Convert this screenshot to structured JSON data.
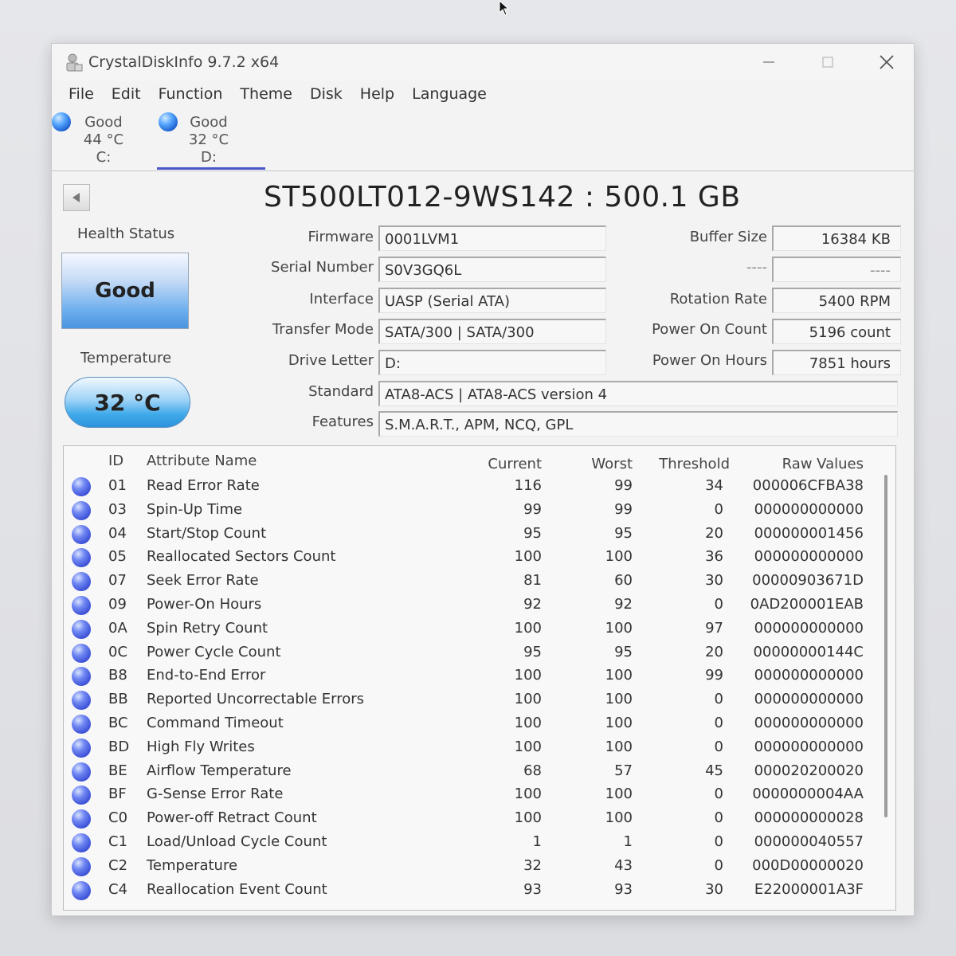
{
  "window": {
    "title": "CrystalDiskInfo 9.7.2 x64"
  },
  "menu": [
    "File",
    "Edit",
    "Function",
    "Theme",
    "Disk",
    "Help",
    "Language"
  ],
  "drives": [
    {
      "status": "Good",
      "temp": "44 °C",
      "letter": "C:"
    },
    {
      "status": "Good",
      "temp": "32 °C",
      "letter": "D:"
    }
  ],
  "model_title": "ST500LT012-9WS142 : 500.1 GB",
  "health": {
    "label": "Health Status",
    "value": "Good"
  },
  "temperature": {
    "label": "Temperature",
    "value": "32 °C"
  },
  "fields": {
    "firmware": {
      "label": "Firmware",
      "value": "0001LVM1"
    },
    "serial": {
      "label": "Serial Number",
      "value": "S0V3GQ6L"
    },
    "interface": {
      "label": "Interface",
      "value": "UASP (Serial ATA)"
    },
    "transfer": {
      "label": "Transfer Mode",
      "value": "SATA/300 | SATA/300"
    },
    "letter": {
      "label": "Drive Letter",
      "value": "D:"
    },
    "standard": {
      "label": "Standard",
      "value": "ATA8-ACS | ATA8-ACS version 4"
    },
    "features": {
      "label": "Features",
      "value": "S.M.A.R.T., APM, NCQ, GPL"
    },
    "buffer": {
      "label": "Buffer Size",
      "value": "16384 KB"
    },
    "blank": {
      "label": "----",
      "value": "----"
    },
    "rotation": {
      "label": "Rotation Rate",
      "value": "5400 RPM"
    },
    "power_count": {
      "label": "Power On Count",
      "value": "5196 count"
    },
    "power_hours": {
      "label": "Power On Hours",
      "value": "7851 hours"
    }
  },
  "table": {
    "headers": {
      "id": "ID",
      "name": "Attribute Name",
      "current": "Current",
      "worst": "Worst",
      "threshold": "Threshold",
      "raw": "Raw Values"
    },
    "rows": [
      {
        "id": "01",
        "name": "Read Error Rate",
        "current": "116",
        "worst": "99",
        "threshold": "34",
        "raw": "000006CFBA38"
      },
      {
        "id": "03",
        "name": "Spin-Up Time",
        "current": "99",
        "worst": "99",
        "threshold": "0",
        "raw": "000000000000"
      },
      {
        "id": "04",
        "name": "Start/Stop Count",
        "current": "95",
        "worst": "95",
        "threshold": "20",
        "raw": "000000001456"
      },
      {
        "id": "05",
        "name": "Reallocated Sectors Count",
        "current": "100",
        "worst": "100",
        "threshold": "36",
        "raw": "000000000000"
      },
      {
        "id": "07",
        "name": "Seek Error Rate",
        "current": "81",
        "worst": "60",
        "threshold": "30",
        "raw": "00000903671D"
      },
      {
        "id": "09",
        "name": "Power-On Hours",
        "current": "92",
        "worst": "92",
        "threshold": "0",
        "raw": "0AD200001EAB"
      },
      {
        "id": "0A",
        "name": "Spin Retry Count",
        "current": "100",
        "worst": "100",
        "threshold": "97",
        "raw": "000000000000"
      },
      {
        "id": "0C",
        "name": "Power Cycle Count",
        "current": "95",
        "worst": "95",
        "threshold": "20",
        "raw": "00000000144C"
      },
      {
        "id": "B8",
        "name": "End-to-End Error",
        "current": "100",
        "worst": "100",
        "threshold": "99",
        "raw": "000000000000"
      },
      {
        "id": "BB",
        "name": "Reported Uncorrectable Errors",
        "current": "100",
        "worst": "100",
        "threshold": "0",
        "raw": "000000000000"
      },
      {
        "id": "BC",
        "name": "Command Timeout",
        "current": "100",
        "worst": "100",
        "threshold": "0",
        "raw": "000000000000"
      },
      {
        "id": "BD",
        "name": "High Fly Writes",
        "current": "100",
        "worst": "100",
        "threshold": "0",
        "raw": "000000000000"
      },
      {
        "id": "BE",
        "name": "Airflow Temperature",
        "current": "68",
        "worst": "57",
        "threshold": "45",
        "raw": "000020200020"
      },
      {
        "id": "BF",
        "name": "G-Sense Error Rate",
        "current": "100",
        "worst": "100",
        "threshold": "0",
        "raw": "0000000004AA"
      },
      {
        "id": "C0",
        "name": "Power-off Retract Count",
        "current": "100",
        "worst": "100",
        "threshold": "0",
        "raw": "000000000028"
      },
      {
        "id": "C1",
        "name": "Load/Unload Cycle Count",
        "current": "1",
        "worst": "1",
        "threshold": "0",
        "raw": "000000040557"
      },
      {
        "id": "C2",
        "name": "Temperature",
        "current": "32",
        "worst": "43",
        "threshold": "0",
        "raw": "000D00000020"
      },
      {
        "id": "C4",
        "name": "Reallocation Event Count",
        "current": "93",
        "worst": "93",
        "threshold": "30",
        "raw": "E22000001A3F"
      }
    ]
  },
  "icons": {
    "app": "disk-info-app-icon",
    "back": "back-arrow-icon",
    "status_dot": "status-dot-icon",
    "cursor": "mouse-cursor-icon"
  }
}
